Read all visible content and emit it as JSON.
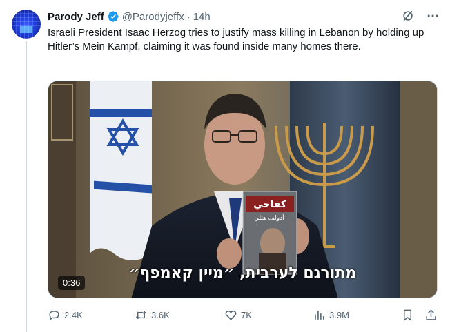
{
  "author": {
    "name": "Parody Jeff",
    "handle": "@Parodyjeffx",
    "separator": "·",
    "time": "14h"
  },
  "tweet": {
    "text": "Israeli President Isaac Herzog tries to justify mass killing in Lebanon by holding up Hitler’s Mein Kampf, claiming it was found inside many homes there."
  },
  "media": {
    "subtitle": "מתורגם לערבית, ״מיין קאמפף״",
    "duration": "0:36",
    "book_title": "كفاحي",
    "book_author": "أدولف هتلر"
  },
  "actions": {
    "replies": "2.4K",
    "reposts": "3.6K",
    "likes": "7K",
    "views": "3.9M"
  },
  "colors": {
    "text": "#0f1419",
    "muted": "#536471",
    "verified": "#1d9bf0",
    "border": "#cfd9de"
  }
}
